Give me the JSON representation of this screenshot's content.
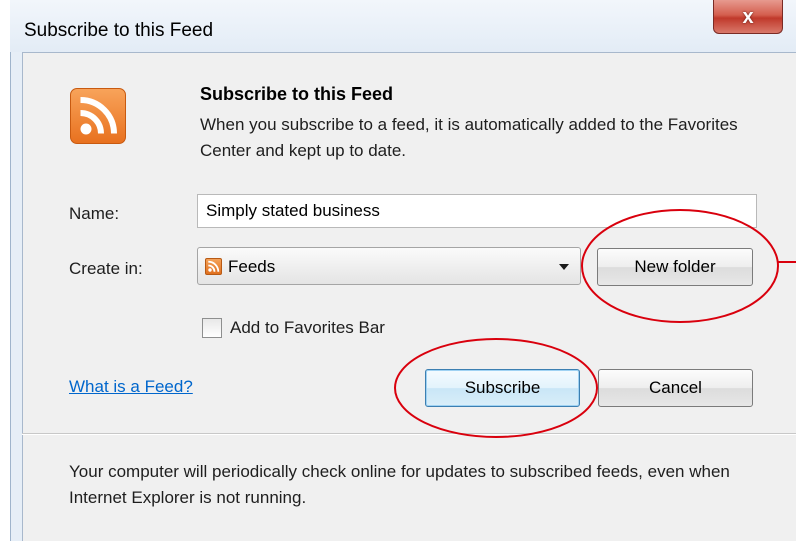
{
  "window": {
    "title": "Subscribe to this Feed",
    "close_symbol": "x"
  },
  "dialog": {
    "heading": "Subscribe to this Feed",
    "description": "When you subscribe to a feed, it is automatically added to the Favorites Center and kept up to date.",
    "logo_icon": "rss-feed-icon",
    "name_label": "Name:",
    "name_value": "Simply stated business",
    "create_in_label": "Create in:",
    "create_in_value": "Feeds",
    "create_in_icon": "rss-feed-icon",
    "new_folder_label": "New folder",
    "favorites_bar_label": "Add to Favorites Bar",
    "favorites_bar_checked": false,
    "what_is_feed_link": "What is a Feed?",
    "subscribe_label": "Subscribe",
    "cancel_label": "Cancel",
    "footer_text": "Your computer will periodically check online for updates to subscribed feeds, even when Internet Explorer is not running."
  },
  "colors": {
    "accent_link": "#0066cc",
    "annotation_red": "#d9000d",
    "rss_orange": "#e8711f",
    "close_red": "#c0392b"
  }
}
